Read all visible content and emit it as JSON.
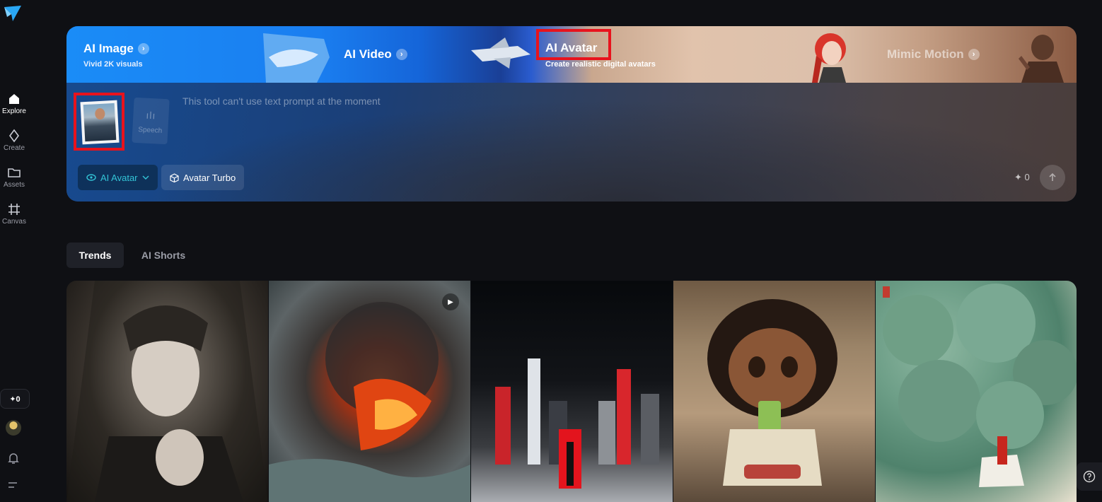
{
  "sidebar": {
    "items": [
      {
        "label": "Explore",
        "icon": "home-icon",
        "active": true
      },
      {
        "label": "Create",
        "icon": "sparkle-diamond-icon"
      },
      {
        "label": "Assets",
        "icon": "folder-icon"
      },
      {
        "label": "Canvas",
        "icon": "crop-frame-icon"
      }
    ],
    "credits": "✦0"
  },
  "hero": {
    "tabs": [
      {
        "title": "AI Image",
        "subtitle": "Vivid 2K visuals"
      },
      {
        "title": "AI Video",
        "subtitle": ""
      },
      {
        "title": "AI Avatar",
        "subtitle": "Create realistic digital avatars"
      },
      {
        "title": "Mimic Motion",
        "subtitle": ""
      }
    ],
    "chevron": "›"
  },
  "prompt": {
    "placeholder": "This tool can't use text prompt at the moment",
    "speech_label": "Speech",
    "tool_chip": "AI Avatar",
    "model_chip": "Avatar Turbo",
    "credits": "✦ 0"
  },
  "sections": {
    "tabs": [
      "Trends",
      "AI Shorts"
    ]
  },
  "colors": {
    "highlight": "#e8131d",
    "accent": "#33c4d6",
    "background": "#0f1014"
  }
}
